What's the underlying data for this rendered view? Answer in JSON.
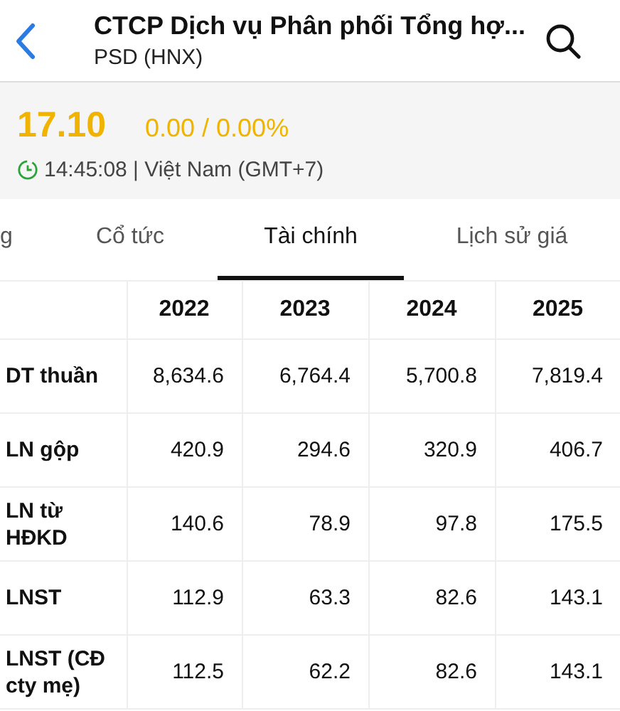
{
  "header": {
    "title": "CTCP Dịch vụ Phân phối Tổng hợ...",
    "subtitle": "PSD (HNX)"
  },
  "quote": {
    "price": "17.10",
    "change": "0.00 / 0.00%",
    "time": "14:45:08 | Việt Nam (GMT+7)"
  },
  "tabs": [
    {
      "label": "g",
      "selected": false
    },
    {
      "label": "Cổ tức",
      "selected": false
    },
    {
      "label": "Tài chính",
      "selected": true
    },
    {
      "label": "Lịch sử giá",
      "selected": false
    }
  ],
  "table": {
    "columns": [
      "2022",
      "2023",
      "2024",
      "2025"
    ],
    "rows": [
      {
        "label": "DT thuần",
        "values": [
          "8,634.6",
          "6,764.4",
          "5,700.8",
          "7,819.4"
        ]
      },
      {
        "label": "LN gộp",
        "values": [
          "420.9",
          "294.6",
          "320.9",
          "406.7"
        ]
      },
      {
        "label": "LN từ HĐKD",
        "values": [
          "140.6",
          "78.9",
          "97.8",
          "175.5"
        ]
      },
      {
        "label": "LNST",
        "values": [
          "112.9",
          "63.3",
          "82.6",
          "143.1"
        ]
      },
      {
        "label": "LNST (CĐ cty mẹ)",
        "values": [
          "112.5",
          "62.2",
          "82.6",
          "143.1"
        ]
      }
    ]
  }
}
